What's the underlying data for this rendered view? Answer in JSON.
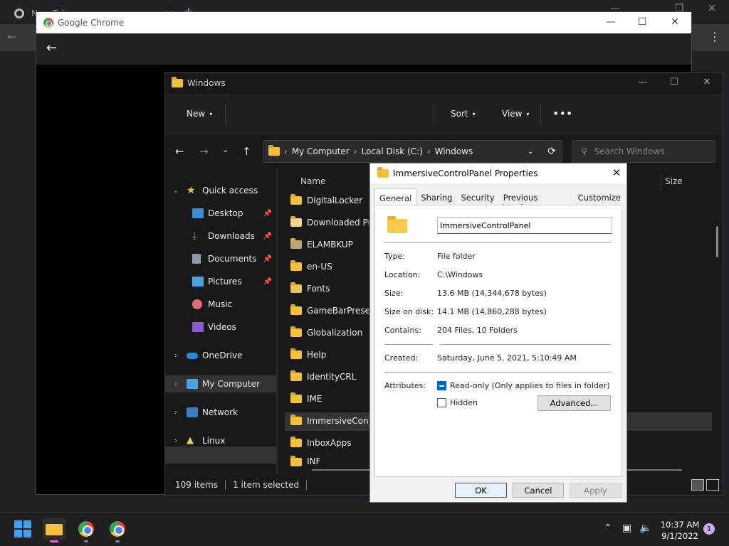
{
  "chrome_bg": {
    "tab_title": "New Tab"
  },
  "chrome_window": {
    "title": "Google Chrome"
  },
  "explorer": {
    "title": "Windows",
    "cmd": {
      "new": "New",
      "sort": "Sort",
      "view": "View"
    },
    "address": [
      "My Computer",
      "Local Disk (C:)",
      "Windows"
    ],
    "search_placeholder": "Search Windows",
    "sidebar": [
      {
        "label": "Quick access",
        "icon": "star-icon",
        "chevron": "open"
      },
      {
        "label": "Desktop",
        "icon": "desktop-icon",
        "pinned": true
      },
      {
        "label": "Downloads",
        "icon": "downloads-icon",
        "pinned": true
      },
      {
        "label": "Documents",
        "icon": "documents-icon",
        "pinned": true
      },
      {
        "label": "Pictures",
        "icon": "pictures-icon",
        "pinned": true
      },
      {
        "label": "Music",
        "icon": "music-icon"
      },
      {
        "label": "Videos",
        "icon": "videos-icon"
      },
      {
        "label": "OneDrive",
        "icon": "cloud-icon",
        "chevron": "closed"
      },
      {
        "label": "My Computer",
        "icon": "computer-icon",
        "chevron": "closed",
        "selected": true
      },
      {
        "label": "Network",
        "icon": "network-icon",
        "chevron": "closed"
      },
      {
        "label": "Linux",
        "icon": "linux-icon",
        "chevron": "closed"
      }
    ],
    "columns": {
      "name": "Name",
      "size": "Size"
    },
    "files": [
      "DigitalLocker",
      "Downloaded Pro",
      "ELAMBKUP",
      "en-US",
      "Fonts",
      "GameBarPresenc",
      "Globalization",
      "Help",
      "IdentityCRL",
      "IME",
      "ImmersiveContro",
      "InboxApps",
      "INF"
    ],
    "status": {
      "items": "109 items",
      "selected": "1 item selected"
    }
  },
  "dialog": {
    "title": "ImmersiveControlPanel Properties",
    "tabs": [
      "General",
      "Sharing",
      "Security",
      "Previous Versions",
      "Customize"
    ],
    "folder_name": "ImmersiveControlPanel",
    "props": [
      {
        "label": "Type:",
        "value": "File folder"
      },
      {
        "label": "Location:",
        "value": "C:\\Windows"
      },
      {
        "label": "Size:",
        "value": "13.6 MB (14,344,678 bytes)"
      },
      {
        "label": "Size on disk:",
        "value": "14.1 MB (14,860,288 bytes)"
      },
      {
        "label": "Contains:",
        "value": "204 Files, 10 Folders"
      }
    ],
    "created_label": "Created:",
    "created_value": "Saturday, June 5, 2021, 5:10:49 AM",
    "attributes_label": "Attributes:",
    "readonly_label": "Read-only (Only applies to files in folder)",
    "hidden_label": "Hidden",
    "advanced_label": "Advanced...",
    "ok": "OK",
    "cancel": "Cancel",
    "apply": "Apply"
  },
  "taskbar": {
    "time": "10:37 AM",
    "date": "9/1/2022",
    "notifications": "1"
  },
  "colors": {
    "accent": "#0067c0",
    "folder": "#f3c13a"
  }
}
